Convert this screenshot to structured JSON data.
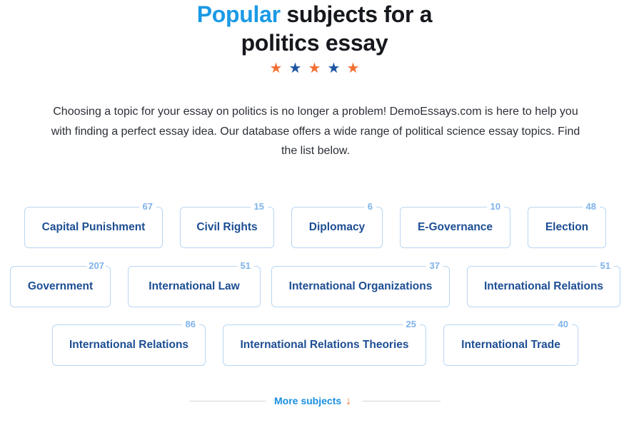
{
  "heading": {
    "accent": "Popular",
    "rest_line1": " subjects for a",
    "line2": "politics essay"
  },
  "rating": {
    "stars": [
      {
        "glyph": "★",
        "color": "#f07134"
      },
      {
        "glyph": "★",
        "color": "#1d57a3"
      },
      {
        "glyph": "★",
        "color": "#f07134"
      },
      {
        "glyph": "★",
        "color": "#1d57a3"
      },
      {
        "glyph": "★",
        "color": "#f07134"
      }
    ]
  },
  "intro": "Choosing a topic for your essay on politics is no longer a problem! DemoEssays.com is here to help you with finding a perfect essay idea. Our database offers a wide range of political science essay topics. Find the list below.",
  "subjects": [
    {
      "label": "Capital Punishment",
      "count": "67"
    },
    {
      "label": "Civil Rights",
      "count": "15"
    },
    {
      "label": "Diplomacy",
      "count": "6"
    },
    {
      "label": "E-Governance",
      "count": "10"
    },
    {
      "label": "Election",
      "count": "48"
    },
    {
      "label": "Government",
      "count": "207"
    },
    {
      "label": "International Law",
      "count": "51"
    },
    {
      "label": "International Organizations",
      "count": "37"
    },
    {
      "label": "International Relations",
      "count": "51"
    },
    {
      "label": "International Relations",
      "count": "86"
    },
    {
      "label": "International Relations Theories",
      "count": "25"
    },
    {
      "label": "International Trade",
      "count": "40"
    }
  ],
  "more": {
    "label": "More subjects",
    "icon": "↓"
  },
  "colors": {
    "accent_blue": "#1a9ae6",
    "subject_text": "#1d4e93",
    "count_text": "#7fb3ea",
    "border": "#b9d6f2",
    "orange": "#f07134"
  }
}
